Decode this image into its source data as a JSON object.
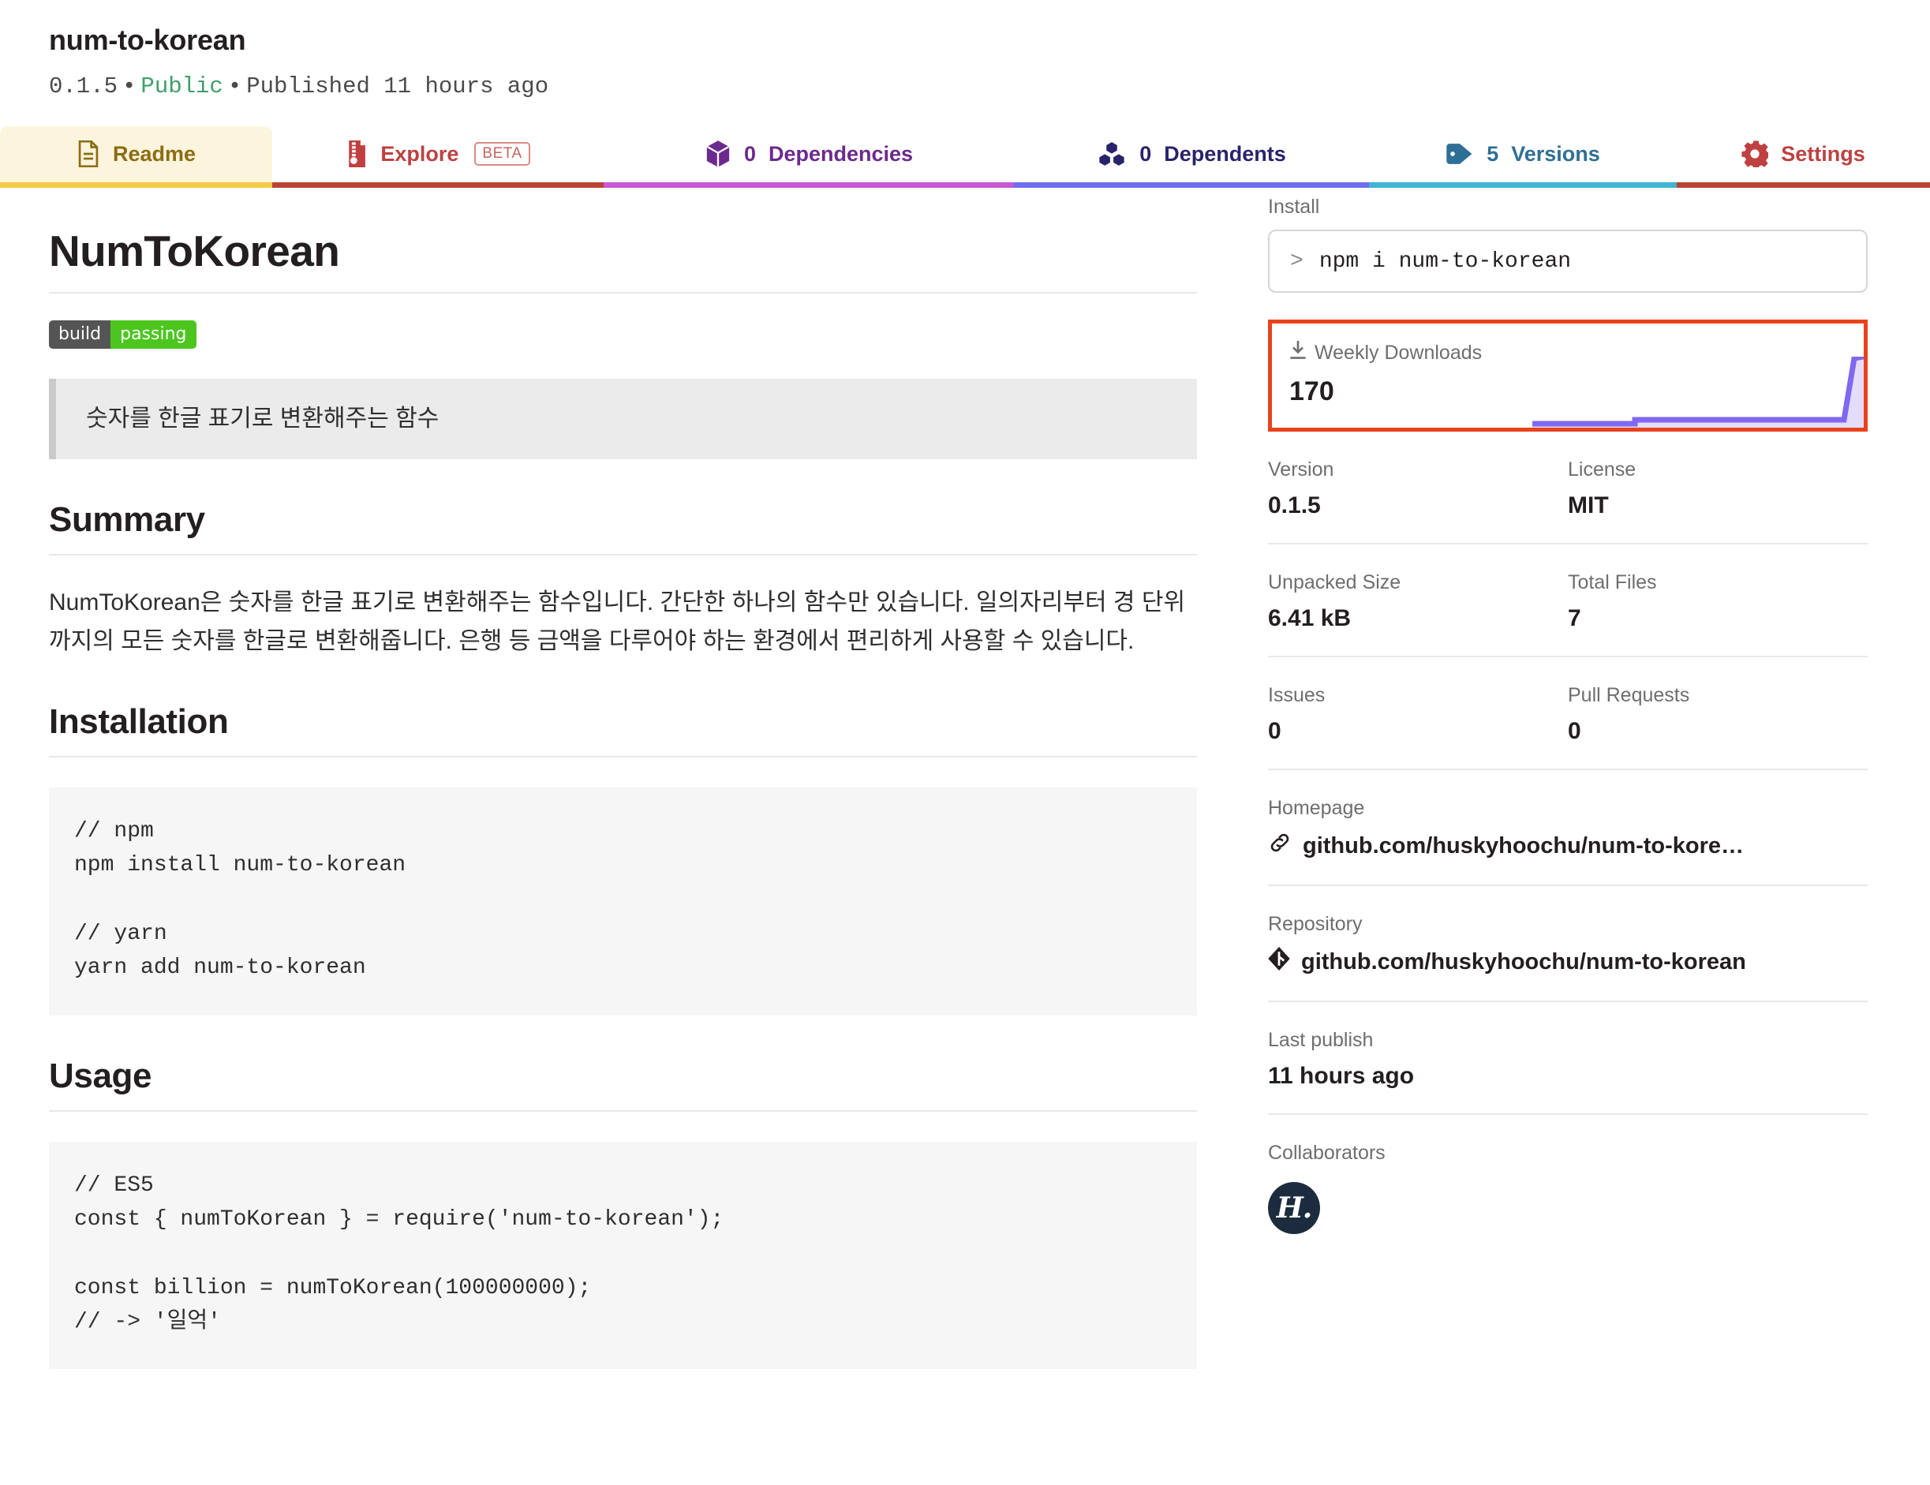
{
  "header": {
    "package_name": "num-to-korean",
    "version": "0.1.5",
    "visibility": "Public",
    "published": "Published 11 hours ago",
    "separator": "•"
  },
  "tabs": [
    {
      "id": "readme",
      "label": "Readme",
      "count": "",
      "icon": "document-icon",
      "active": true
    },
    {
      "id": "explore",
      "label": "Explore",
      "count": "",
      "icon": "file-zip-icon",
      "badge": "BETA"
    },
    {
      "id": "dependencies",
      "label": "Dependencies",
      "count": "0",
      "icon": "cube-icon"
    },
    {
      "id": "dependents",
      "label": "Dependents",
      "count": "0",
      "icon": "cubes-icon"
    },
    {
      "id": "versions",
      "label": "Versions",
      "count": "5",
      "icon": "tag-icon"
    },
    {
      "id": "settings",
      "label": "Settings",
      "count": "",
      "icon": "gear-icon"
    }
  ],
  "readme": {
    "title": "NumToKorean",
    "build_badge": {
      "left": "build",
      "right": "passing"
    },
    "blockquote": "숫자를 한글 표기로 변환해주는 함수",
    "summary_heading": "Summary",
    "summary_text": "NumToKorean은 숫자를 한글 표기로 변환해주는 함수입니다. 간단한 하나의 함수만 있습니다. 일의자리부터 경 단위까지의 모든 숫자를 한글로 변환해줍니다. 은행 등 금액을 다루어야 하는 환경에서 편리하게 사용할 수 있습니다.",
    "installation_heading": "Installation",
    "installation_code": "// npm\nnpm install num-to-korean\n\n// yarn\nyarn add num-to-korean",
    "usage_heading": "Usage",
    "usage_code": "// ES5\nconst { numToKorean } = require('num-to-korean');\n\nconst billion = numToKorean(100000000);\n// -> '일억'"
  },
  "sidebar": {
    "install_label": "Install",
    "install_command": "npm i num-to-korean",
    "install_prompt": ">",
    "downloads_label": "Weekly Downloads",
    "downloads_count": "170",
    "version_label": "Version",
    "version_value": "0.1.5",
    "license_label": "License",
    "license_value": "MIT",
    "unpacked_label": "Unpacked Size",
    "unpacked_value": "6.41 kB",
    "files_label": "Total Files",
    "files_value": "7",
    "issues_label": "Issues",
    "issues_value": "0",
    "pulls_label": "Pull Requests",
    "pulls_value": "0",
    "homepage_label": "Homepage",
    "homepage_value": "github.com/huskyhoochu/num-to-kore…",
    "repository_label": "Repository",
    "repository_value": "github.com/huskyhoochu/num-to-korean",
    "lastpublish_label": "Last publish",
    "lastpublish_value": "11 hours ago",
    "collaborators_label": "Collaborators",
    "collaborator_initial": "H."
  },
  "chart_data": {
    "type": "line",
    "title": "Weekly Downloads",
    "values": [
      0,
      0,
      0,
      0,
      0,
      0,
      2,
      2,
      2,
      2,
      2,
      2,
      2,
      2,
      2,
      2,
      2,
      2,
      2,
      2,
      170
    ],
    "ylim": [
      0,
      170
    ],
    "grid": false,
    "legend": false,
    "line_color": "#8068f0",
    "fill_color": "#e3ddfa"
  },
  "colors": {
    "accent_red": "#e8421c",
    "readme_tab_bg": "#fdf4dd",
    "readme_tab_fg": "#8a6d12",
    "explore": "#bf4040",
    "dependencies": "#6c2a8e",
    "dependents": "#29236b",
    "versions": "#2f6f96",
    "settings": "#bf4040",
    "public_green": "#3f9e6a",
    "spark_purple": "#8068f0"
  }
}
